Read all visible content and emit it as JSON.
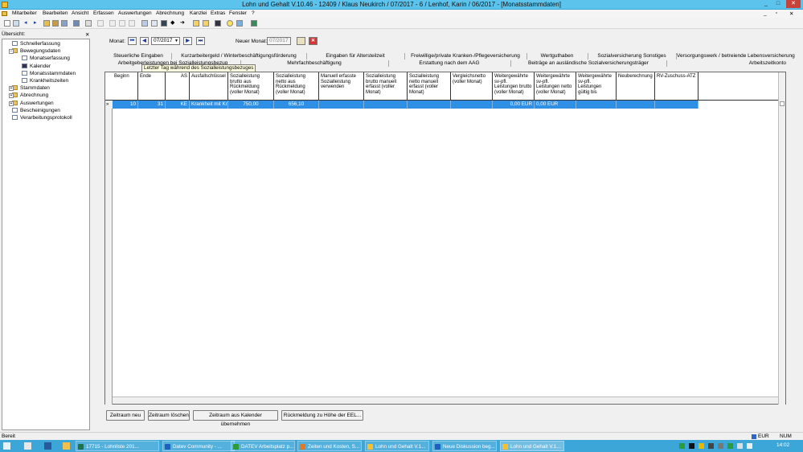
{
  "window": {
    "title": "Lohn und Gehalt V.10.46 - 12409 / Klaus Neukirch / 07/2017 - 6 / Lenhof, Karin / 06/2017 - [Monatsstammdaten]",
    "minimize": "_",
    "restore": "□",
    "close": "✕",
    "mdi_minimize": "_",
    "mdi_restore": "▫",
    "mdi_close": "✕"
  },
  "menu": [
    "Mitarbeiter",
    "Bearbeiten",
    "Ansicht",
    "Erfassen",
    "Auswertungen",
    "Abrechnung",
    "Kanzlei",
    "Extras",
    "Fenster",
    "?"
  ],
  "left": {
    "header": "Übersicht:",
    "close": "✕",
    "tree": [
      {
        "label": "Schnellerfassung",
        "level": 0,
        "expander": "",
        "icon": "page"
      },
      {
        "label": "Bewegungsdaten",
        "level": 0,
        "expander": "−",
        "icon": "folder"
      },
      {
        "label": "Monatserfassung",
        "level": 1,
        "expander": "",
        "icon": "page"
      },
      {
        "label": "Kalender",
        "level": 1,
        "expander": "",
        "icon": "calendar"
      },
      {
        "label": "Monatsstammdaten",
        "level": 1,
        "expander": "",
        "icon": "page"
      },
      {
        "label": "Krankheitszeiten",
        "level": 1,
        "expander": "",
        "icon": "page"
      },
      {
        "label": "Stammdaten",
        "level": 0,
        "expander": "+",
        "icon": "folder"
      },
      {
        "label": "Abrechnung",
        "level": 0,
        "expander": "+",
        "icon": "folder"
      },
      {
        "label": "Auswertungen",
        "level": 0,
        "expander": "+",
        "icon": "folder"
      },
      {
        "label": "Bescheinigungen",
        "level": 0,
        "expander": "",
        "icon": "page"
      },
      {
        "label": "Verarbeitungsprotokoll",
        "level": 0,
        "expander": "",
        "icon": "page"
      }
    ]
  },
  "month": {
    "label": "Monat:",
    "value": "07/2017",
    "new_label": "Neuer Monat:",
    "new_value": "07/2017"
  },
  "tabs_row1": [
    "Steuerliche Eingaben",
    "Kurzarbeitergeld / Winterbeschäftigungsförderung",
    "Eingaben für Altersteilzeit",
    "Freiwillige/private Kranken-/Pflegeversicherung",
    "Wertguthaben",
    "Sozialversicherung Sonstiges",
    "Versorgungswerk / betreiende Lebensversicherung"
  ],
  "tabs_row2": [
    "Arbeitgeberleistungen bei Sozialleistungsbezug",
    "Mehrfachbeschäftigung",
    "Erstattung nach dem AAG",
    "Beiträge an ausländische Sozialversicherungsträger",
    "Arbeitszeitkonto"
  ],
  "tooltip": "Letzter Tag während des Sozialleistungsbezuges",
  "grid": {
    "columns": [
      "Beginn",
      "Ende",
      "AS",
      "Ausfallschlüssel",
      "Sozialleistung brutto aus Rückmeldung (voller Monat)",
      "Sozialleistung netto aus Rückmeldung (voller Monat)",
      "Manuell erfasste Sozialleistung verwenden",
      "Sozialleistung brutto manuell erfasst (voller Monat)",
      "Sozialleistung netto manuell erfasst (voller Monat)",
      "Vergleichsnetto (voller Monat)",
      "Weitergewährte sv-pfl. Leistungen brutto (voller Monat)",
      "Weitergewährte sv-pfl. Leistungen netto (voller Monat)",
      "Weitergewährte sv-pfl. Leistungen gültig bis",
      "Neuberechnung",
      "RV-Zuschuss-ATZ"
    ],
    "row": [
      "10",
      "31",
      "KE",
      "Krankheit mit Krank",
      "750,00",
      "656,10",
      "",
      "",
      "",
      "",
      "0,00 EUR",
      "0,00 EUR",
      "",
      "",
      ""
    ],
    "row_marker": "»"
  },
  "buttons": [
    "Zeitraum neu",
    "Zeitraum löschen",
    "Zeitraum aus Kalender übernehmen",
    "Rückmeldung zu Höhe der EEL..."
  ],
  "status": {
    "text": "Bereit",
    "currency": "EUR",
    "numlock": "NUM"
  },
  "taskbar": {
    "items": [
      "17715 - Lohnliste 201...",
      "Datev Community - ...",
      "DATEV Arbeitsplatz p...",
      "Zeiten und Kosten, S...",
      "Lohn und Gehalt V.1...",
      "Neue Diskussion beg...",
      "Lohn und Gehalt V.1..."
    ],
    "clock": "14:02"
  },
  "colors": {
    "titlebar": "#5cc3ec",
    "selection": "#2f8fe4",
    "taskbar": "#3da6d8"
  }
}
